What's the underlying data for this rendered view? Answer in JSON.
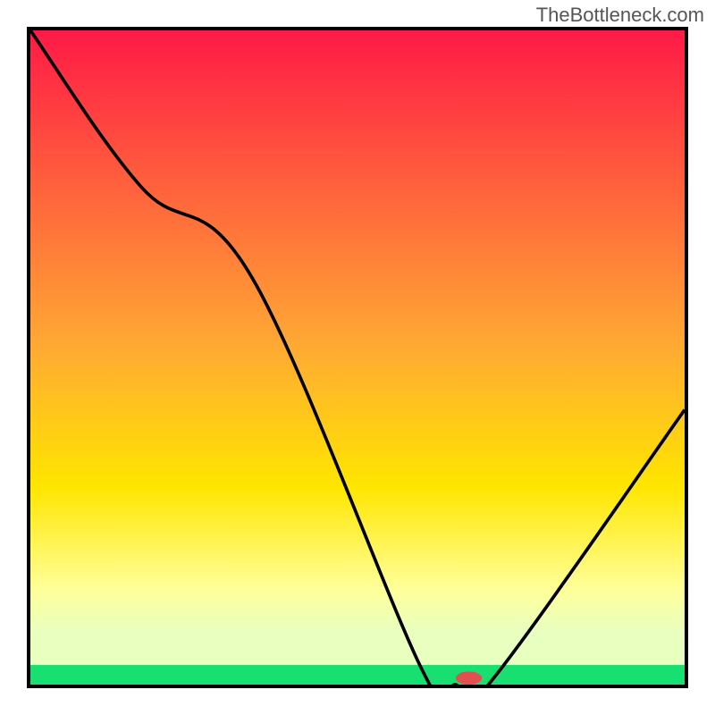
{
  "watermark": "TheBottleneck.com",
  "chart_data": {
    "type": "line",
    "title": "",
    "xlabel": "",
    "ylabel": "",
    "xlim": [
      0,
      100
    ],
    "ylim": [
      0,
      100
    ],
    "grid": false,
    "legend": false,
    "series": [
      {
        "name": "curve",
        "x": [
          0,
          17,
          34,
          60,
          65,
          70,
          100
        ],
        "values": [
          100,
          76,
          62,
          2,
          0,
          0,
          42
        ]
      }
    ],
    "marker": {
      "x": 67,
      "y": 1,
      "color": "#E05050",
      "rx": 2.0,
      "ry": 1.0
    },
    "background": {
      "top_gradient": [
        {
          "offset": 0,
          "color": "#FF1A46"
        },
        {
          "offset": 0.5,
          "color": "#FFAA33"
        },
        {
          "offset": 0.72,
          "color": "#FFE600"
        },
        {
          "offset": 0.88,
          "color": "#FFFF99"
        },
        {
          "offset": 0.95,
          "color": "#E8FFC0"
        }
      ],
      "bottom_band_color": "#18E070",
      "bottom_band_height_pct": 3
    }
  }
}
